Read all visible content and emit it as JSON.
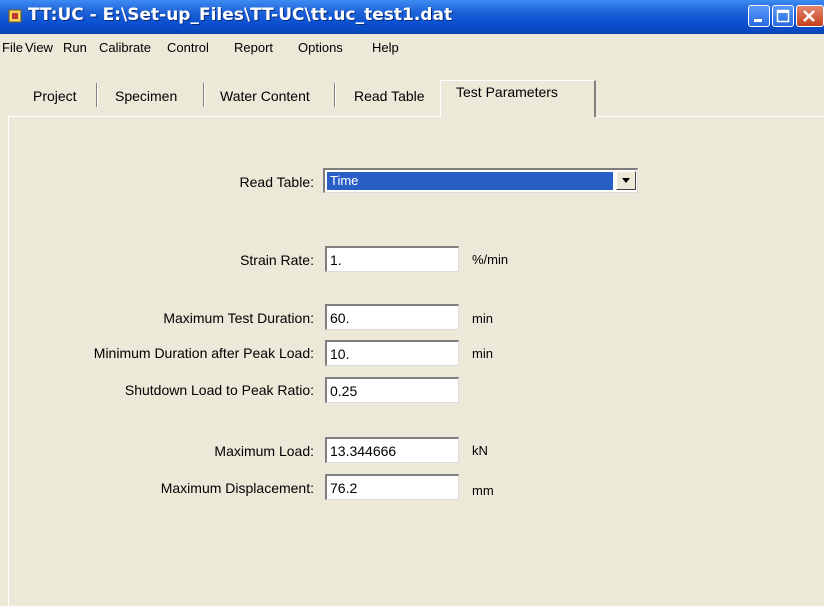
{
  "window": {
    "title": "TT:UC - E:\\Set-up_Files\\TT-UC\\tt.uc_test1.dat",
    "icons": [
      "app-icon",
      "minimize-icon",
      "maximize-icon",
      "close-icon"
    ]
  },
  "menu": {
    "file": "File",
    "view": "View",
    "run": "Run",
    "calibrate": "Calibrate",
    "control": "Control",
    "report": "Report",
    "options": "Options",
    "help": "Help"
  },
  "tabs": {
    "project": "Project",
    "specimen": "Specimen",
    "water_content": "Water Content",
    "read_table": "Read Table",
    "test_parameters": "Test Parameters",
    "active": "Test Parameters"
  },
  "form": {
    "read_table_label": "Read Table:",
    "read_table_value": "Time",
    "strain_rate_label": "Strain Rate:",
    "strain_rate_value": "1.",
    "strain_rate_unit": "%/min",
    "max_duration_label": "Maximum Test Duration:",
    "max_duration_value": "60.",
    "max_duration_unit": "min",
    "min_after_peak_label": "Minimum Duration after Peak Load:",
    "min_after_peak_value": "10.",
    "min_after_peak_unit": "min",
    "shutdown_ratio_label": "Shutdown Load to Peak Ratio:",
    "shutdown_ratio_value": "0.25",
    "max_load_label": "Maximum Load:",
    "max_load_value": "13.344666",
    "max_load_unit": "kN",
    "max_disp_label": "Maximum Displacement:",
    "max_disp_value": "76.2",
    "max_disp_unit": "mm"
  },
  "colors": {
    "titlebar": "#0a4fcf",
    "face": "#ece9d8",
    "selection": "#2a5ec7",
    "close_button": "#c4411f"
  }
}
